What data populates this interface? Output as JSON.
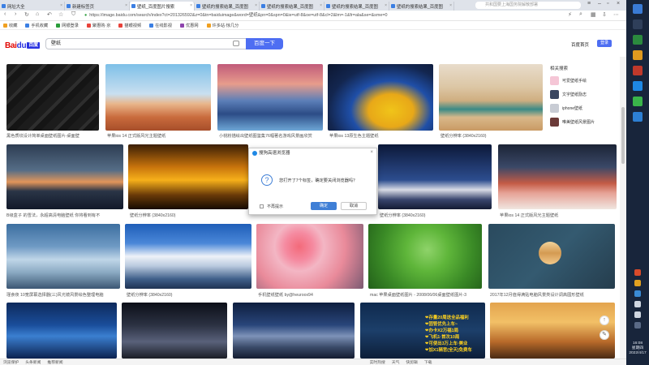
{
  "tabs": [
    {
      "label": "网址大全"
    },
    {
      "label": "新建标签页"
    },
    {
      "label": "壁纸_百度图片搜索"
    },
    {
      "label": "壁纸的搜索结果_百度图"
    },
    {
      "label": "壁纸的搜索结果_百度图"
    },
    {
      "label": "壁纸的搜索结果_百度图"
    },
    {
      "label": "壁纸的搜索结果_百度图"
    }
  ],
  "tab_search_placeholder": "共和国要上海国务院解散部署",
  "address": {
    "url": "https://image.baidu.com/search/index?ct=201326592&z=0&tn=baiduimage&word=壁纸&pn=0&spn=0&ie=utf-8&oe=utf-8&cl=2&lm=-1&fr=ala&se=&sme=0"
  },
  "bookmarks": [
    {
      "label": "收藏",
      "color": "#f0a020"
    },
    {
      "label": "手机收藏",
      "color": "#3b7fe3"
    },
    {
      "label": "网银登录",
      "color": "#2a9d3a"
    },
    {
      "label": "聚惠购·京",
      "color": "#e8423a"
    },
    {
      "label": "猫眼视频",
      "color": "#e8423a"
    },
    {
      "label": "在线影视",
      "color": "#3b7fe3"
    },
    {
      "label": "优惠网",
      "color": "#8e44ad"
    },
    {
      "label": "许多站·惊几分",
      "color": "#f0a020"
    }
  ],
  "header": {
    "logo_text": "Bai",
    "logo_paw": "du",
    "logo_cn": "百度",
    "search_value": "壁纸",
    "search_button": "百度一下",
    "home_link": "百度首页",
    "login_button": "登录"
  },
  "row1": [
    {
      "caption": "黑色质纹设计简单桌面壁纸图片-桌面壁"
    },
    {
      "caption": "苹果ios 14 正式版风光主题壁纸"
    },
    {
      "caption": "小桃粉描绘出壁纸图鉴集76幅著名游戏风景画欣赏"
    },
    {
      "caption": "苹果ios 13原生色主题壁纸"
    },
    {
      "caption": "壁纸分辨率 (3840x2160)"
    }
  ],
  "row2": [
    {
      "caption": "B级盒子 的雪法，永超高清电脑壁纸 你将看到有不"
    },
    {
      "caption": "壁纸分辨率 (3840x2160)"
    },
    {
      "caption": ""
    },
    {
      "caption": "壁纸分辨率 (3840x2160)"
    },
    {
      "caption": "苹果ios 14 正式版风光主题壁纸"
    }
  ],
  "row3": [
    {
      "caption": "瑾食夜 10宽屏幕选择器(三)风光镜风景绘色整理电脑"
    },
    {
      "caption": "壁纸分辨率 (3840x2160)"
    },
    {
      "caption": "手机壁纸壁纸 by@heuroox94"
    },
    {
      "caption": "mac 苹果桌面壁纸图片 - 2008/06/06桌面壁纸图片-3"
    },
    {
      "caption": "2017年12月值得满贴电脑风景类设计调高圆形壁纸"
    }
  ],
  "yellow_lines": [
    "❤存量20周送全品福利",
    "❤固管优先上车~",
    "❤办卡X2万福1局",
    "❤飞机1·首次10局",
    "❤可使出3万上车·美业",
    "❤加X1辆官(全天)免费车"
  ],
  "related": {
    "title": "相关搜索",
    "items": [
      {
        "label": "可爱壁纸手绘",
        "color": "#f5c6d6"
      },
      {
        "label": "文字壁纸励志",
        "color": "#3a4660"
      },
      {
        "label": "iphone壁纸",
        "color": "#c8ccd4"
      },
      {
        "label": "唯美壁纸风景图片",
        "color": "#6b3a38"
      }
    ]
  },
  "dialog": {
    "title": "搜狗高速浏览器",
    "message": "您打开了7个标签，确定要关闭浏览器吗？",
    "checkbox_label": "不再提示",
    "ok": "确定",
    "cancel": "取消"
  },
  "statusbar": [
    "浏览保护",
    "头条新闻",
    "推荐新闻",
    "实时热搜",
    "天气",
    "快剪辑",
    "下载"
  ],
  "clock": {
    "time": "16:08",
    "weekday": "星期四",
    "date": "2022/4/17"
  }
}
